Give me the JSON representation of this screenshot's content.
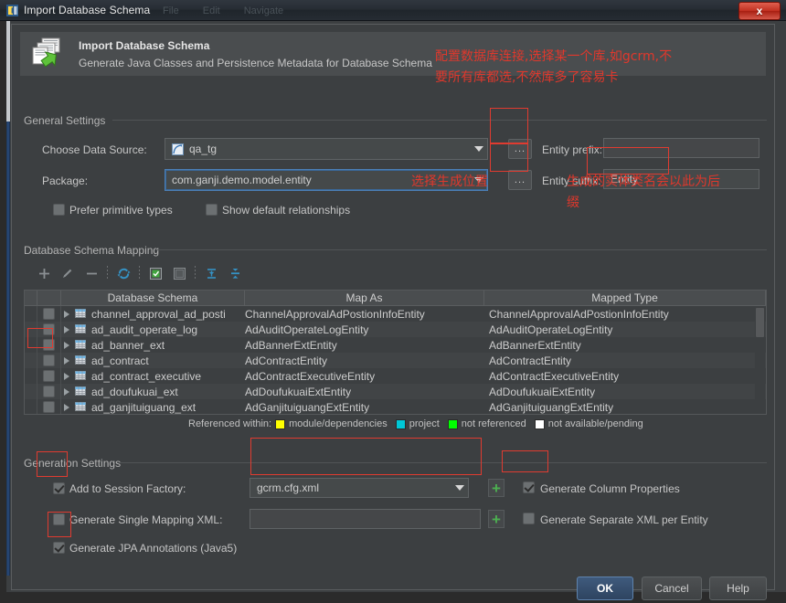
{
  "window": {
    "title": "Import Database Schema",
    "title_icon": "intellij-logo-icon",
    "close_label": "x",
    "ghost_tabs": [
      "File",
      "Edit",
      "Navigate"
    ]
  },
  "banner": {
    "icon": "import-schema-icon",
    "title": "Import Database Schema",
    "subtitle": "Generate Java Classes and Persistence Metadata for Database Schema"
  },
  "general_settings": {
    "group_label": "General Settings",
    "data_source_label": "Choose Data Source:",
    "data_source_value": "qa_tg",
    "data_source_icon": "datasource-icon",
    "data_source_browse": "...",
    "package_label": "Package:",
    "package_value": "com.ganji.demo.model.entity",
    "package_browse": "...",
    "entity_prefix_label": "Entity prefix:",
    "entity_prefix_value": "",
    "entity_suffix_label": "Entity suffix:",
    "entity_suffix_value": "Entity",
    "prefer_primitive_label": "Prefer primitive types",
    "prefer_primitive_checked": false,
    "show_default_rel_label": "Show default relationships",
    "show_default_rel_checked": false
  },
  "schema_mapping": {
    "group_label": "Database Schema Mapping",
    "toolbar": [
      {
        "name": "add-button",
        "glyph": "+"
      },
      {
        "name": "edit-button",
        "glyph": "pencil"
      },
      {
        "name": "remove-button",
        "glyph": "-"
      },
      {
        "name": "refresh-button",
        "glyph": "refresh"
      },
      {
        "name": "select-all-button",
        "glyph": "checked-box"
      },
      {
        "name": "deselect-all-button",
        "glyph": "empty-box"
      },
      {
        "name": "expand-all-button",
        "glyph": "expand-all"
      },
      {
        "name": "collapse-all-button",
        "glyph": "collapse-all"
      }
    ],
    "columns": [
      "Database Schema",
      "Map As",
      "Mapped Type"
    ],
    "rows": [
      {
        "schema": "channel_approval_ad_posti",
        "map_as": "ChannelApprovalAdPostionInfoEntity",
        "mapped_type": "ChannelApprovalAdPostionInfoEntity",
        "checked": false
      },
      {
        "schema": "ad_audit_operate_log",
        "map_as": "AdAuditOperateLogEntity",
        "mapped_type": "AdAuditOperateLogEntity",
        "checked": false
      },
      {
        "schema": "ad_banner_ext",
        "map_as": "AdBannerExtEntity",
        "mapped_type": "AdBannerExtEntity",
        "checked": false
      },
      {
        "schema": "ad_contract",
        "map_as": "AdContractEntity",
        "mapped_type": "AdContractEntity",
        "checked": false
      },
      {
        "schema": "ad_contract_executive",
        "map_as": "AdContractExecutiveEntity",
        "mapped_type": "AdContractExecutiveEntity",
        "checked": false
      },
      {
        "schema": "ad_doufukuai_ext",
        "map_as": "AdDoufukuaiExtEntity",
        "mapped_type": "AdDoufukuaiExtEntity",
        "checked": false
      },
      {
        "schema": "ad_ganjituiguang_ext",
        "map_as": "AdGanjituiguangExtEntity",
        "mapped_type": "AdGanjituiguangExtEntity",
        "checked": false
      }
    ],
    "legend_label": "Referenced within:",
    "legend": [
      {
        "color": "#ffff00",
        "label": "module/dependencies"
      },
      {
        "color": "#00c8d7",
        "label": "project"
      },
      {
        "color": "#00ff00",
        "label": "not referenced"
      },
      {
        "color": "#ffffff",
        "label": "not available/pending"
      }
    ]
  },
  "generation_settings": {
    "group_label": "Generation Settings",
    "add_session_factory_label": "Add to Session Factory:",
    "add_session_factory_checked": true,
    "session_factory_value": "gcrm.cfg.xml",
    "generate_single_xml_label": "Generate Single Mapping XML:",
    "generate_single_xml_checked": false,
    "single_xml_value": "",
    "generate_jpa_label": "Generate JPA Annotations (Java5)",
    "generate_jpa_checked": true,
    "generate_column_props_label": "Generate Column Properties",
    "generate_column_props_checked": true,
    "generate_separate_xml_label": "Generate Separate XML per Entity",
    "generate_separate_xml_checked": false,
    "plus_glyph": "+"
  },
  "footer": {
    "ok": "OK",
    "cancel": "Cancel",
    "help": "Help"
  },
  "annotations": {
    "accent_color": "#e0382c",
    "note_datasource_line1": "配置数据库连接,选择某一个库,如gcrm,不",
    "note_datasource_line2": "要所有库都选,不然库多了容易卡",
    "note_package": "选择生成位置",
    "note_suffix_line1": "生成的实体类名会以此为后",
    "note_suffix_line2": "缀"
  }
}
